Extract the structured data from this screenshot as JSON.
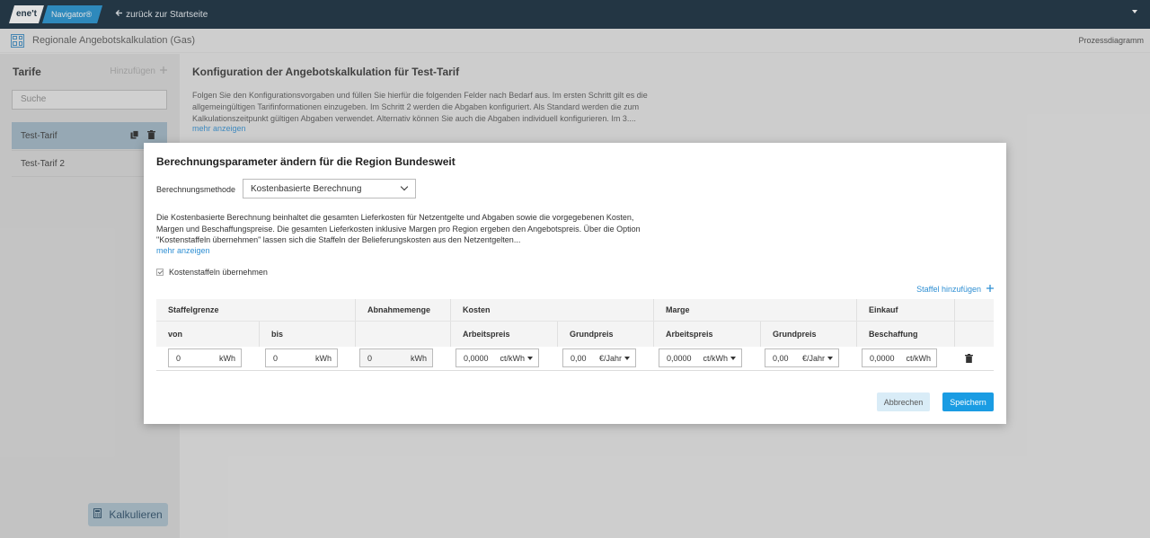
{
  "topbar": {
    "logo_left": "ene't",
    "logo_right": "Navigator®",
    "back_label": "zurück zur Startseite"
  },
  "subheader": {
    "title": "Regionale Angebotskalkulation (Gas)",
    "right_label": "Prozessdiagramm"
  },
  "sidebar": {
    "heading": "Tarife",
    "add_label": "Hinzufügen",
    "search_placeholder": "Suche",
    "items": [
      {
        "label": "Test-Tarif"
      },
      {
        "label": "Test-Tarif 2"
      }
    ],
    "calc_button": "Kalkulieren"
  },
  "main": {
    "title": "Konfiguration der Angebotskalkulation für Test-Tarif",
    "text": "Folgen Sie den Konfigurationsvorgaben und füllen Sie hierfür die folgenden Felder nach Bedarf aus. Im ersten Schritt gilt es die allgemeingültigen Tarifinformationen einzugeben. Im Schritt 2 werden die Abgaben konfiguriert. Als Standard werden die zum Kalkulationszeitpunkt gültigen Abgaben verwendet. Alternativ können Sie auch die Abgaben individuell konfigurieren. Im 3....",
    "more": "mehr anzeigen"
  },
  "modal": {
    "title": "Berechnungsparameter ändern für die Region Bundesweit",
    "method_label": "Berechnungsmethode",
    "method_value": "Kostenbasierte Berechnung",
    "description": "Die Kostenbasierte Berechnung beinhaltet die gesamten Lieferkosten für Netzentgelte und Abgaben sowie die vorgegebenen Kosten, Margen und Beschaffungspreise. Die gesamten Lieferkosten inklusive Margen pro Region ergeben den Angebotspreis. Über die Option \"Kostenstaffeln übernehmen\" lassen sich die Staffeln der Belieferungskosten aus den Netzentgelten...",
    "more": "mehr anzeigen",
    "checkbox_label": "Kostenstaffeln übernehmen",
    "add_staffel": "Staffel hinzufügen",
    "table": {
      "group_headers": [
        "Staffelgrenze",
        "Abnahmemenge",
        "Kosten",
        "Marge",
        "Einkauf"
      ],
      "sub_headers": [
        "von",
        "bis",
        "Arbeitspreis",
        "Grundpreis",
        "Arbeitspreis",
        "Grundpreis",
        "Beschaffung"
      ],
      "row": {
        "von": {
          "value": "0",
          "unit": "kWh"
        },
        "bis": {
          "value": "0",
          "unit": "kWh"
        },
        "abnahme": {
          "value": "0",
          "unit": "kWh"
        },
        "kosten_arbeitspreis": {
          "value": "0,0000",
          "unit": "ct/kWh"
        },
        "kosten_grundpreis": {
          "value": "0,00",
          "unit": "€/Jahr"
        },
        "marge_arbeitspreis": {
          "value": "0,0000",
          "unit": "ct/kWh"
        },
        "marge_grundpreis": {
          "value": "0,00",
          "unit": "€/Jahr"
        },
        "beschaffung": {
          "value": "0,0000",
          "unit": "ct/kWh"
        }
      }
    },
    "cancel_label": "Abbrechen",
    "save_label": "Speichern"
  },
  "colors": {
    "topbar": "#0c2436",
    "accent": "#1a9ce3",
    "link": "#2f8fd3"
  }
}
